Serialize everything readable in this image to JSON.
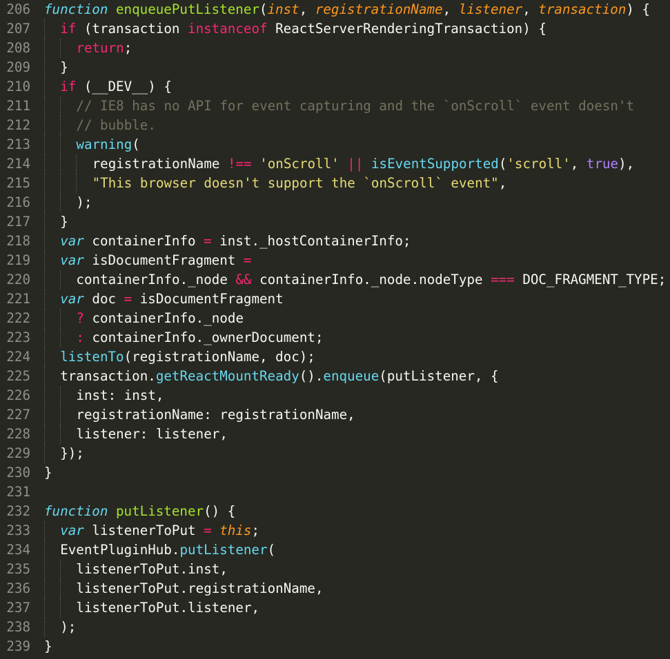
{
  "editor": {
    "theme": {
      "background": "#272822",
      "gutter": "#90908A"
    },
    "lines": [
      {
        "n": "206",
        "indent": 0,
        "tokens": [
          {
            "t": "sk",
            "v": "function"
          },
          {
            "t": "pl",
            "v": " "
          },
          {
            "t": "fn",
            "v": "enqueuePutListener"
          },
          {
            "t": "pl",
            "v": "("
          },
          {
            "t": "pa",
            "v": "inst"
          },
          {
            "t": "pl",
            "v": ", "
          },
          {
            "t": "pa",
            "v": "registrationName"
          },
          {
            "t": "pl",
            "v": ", "
          },
          {
            "t": "pa",
            "v": "listener"
          },
          {
            "t": "pl",
            "v": ", "
          },
          {
            "t": "pa",
            "v": "transaction"
          },
          {
            "t": "pl",
            "v": ") {"
          }
        ]
      },
      {
        "n": "207",
        "indent": 1,
        "tokens": [
          {
            "t": "kw",
            "v": "if"
          },
          {
            "t": "pl",
            "v": " (transaction "
          },
          {
            "t": "kw",
            "v": "instanceof"
          },
          {
            "t": "pl",
            "v": " ReactServerRenderingTransaction) {"
          }
        ]
      },
      {
        "n": "208",
        "indent": 2,
        "tokens": [
          {
            "t": "kw",
            "v": "return"
          },
          {
            "t": "pl",
            "v": ";"
          }
        ]
      },
      {
        "n": "209",
        "indent": 1,
        "tokens": [
          {
            "t": "pl",
            "v": "}"
          }
        ]
      },
      {
        "n": "210",
        "indent": 1,
        "tokens": [
          {
            "t": "kw",
            "v": "if"
          },
          {
            "t": "pl",
            "v": " (__DEV__) {"
          }
        ]
      },
      {
        "n": "211",
        "indent": 2,
        "tokens": [
          {
            "t": "cm",
            "v": "// IE8 has no API for event capturing and the `onScroll` event doesn't"
          }
        ]
      },
      {
        "n": "212",
        "indent": 2,
        "tokens": [
          {
            "t": "cm",
            "v": "// bubble."
          }
        ]
      },
      {
        "n": "213",
        "indent": 2,
        "tokens": [
          {
            "t": "sp",
            "v": "warning"
          },
          {
            "t": "pl",
            "v": "("
          }
        ]
      },
      {
        "n": "214",
        "indent": 3,
        "tokens": [
          {
            "t": "pl",
            "v": "registrationName "
          },
          {
            "t": "kw",
            "v": "!=="
          },
          {
            "t": "pl",
            "v": " "
          },
          {
            "t": "st",
            "v": "'onScroll'"
          },
          {
            "t": "pl",
            "v": " "
          },
          {
            "t": "kw",
            "v": "||"
          },
          {
            "t": "pl",
            "v": " "
          },
          {
            "t": "sp",
            "v": "isEventSupported"
          },
          {
            "t": "pl",
            "v": "("
          },
          {
            "t": "st",
            "v": "'scroll'"
          },
          {
            "t": "pl",
            "v": ", "
          },
          {
            "t": "co",
            "v": "true"
          },
          {
            "t": "pl",
            "v": "),"
          }
        ]
      },
      {
        "n": "215",
        "indent": 3,
        "tokens": [
          {
            "t": "st",
            "v": "\"This browser doesn't support the `onScroll` event\""
          },
          {
            "t": "pl",
            "v": ","
          }
        ]
      },
      {
        "n": "216",
        "indent": 2,
        "tokens": [
          {
            "t": "pl",
            "v": ");"
          }
        ]
      },
      {
        "n": "217",
        "indent": 1,
        "tokens": [
          {
            "t": "pl",
            "v": "}"
          }
        ]
      },
      {
        "n": "218",
        "indent": 1,
        "tokens": [
          {
            "t": "sk",
            "v": "var"
          },
          {
            "t": "pl",
            "v": " containerInfo "
          },
          {
            "t": "kw",
            "v": "="
          },
          {
            "t": "pl",
            "v": " inst._hostContainerInfo;"
          }
        ]
      },
      {
        "n": "219",
        "indent": 1,
        "tokens": [
          {
            "t": "sk",
            "v": "var"
          },
          {
            "t": "pl",
            "v": " isDocumentFragment "
          },
          {
            "t": "kw",
            "v": "="
          }
        ]
      },
      {
        "n": "220",
        "indent": 2,
        "tokens": [
          {
            "t": "pl",
            "v": "containerInfo._node "
          },
          {
            "t": "kw",
            "v": "&&"
          },
          {
            "t": "pl",
            "v": " containerInfo._node.nodeType "
          },
          {
            "t": "kw",
            "v": "==="
          },
          {
            "t": "pl",
            "v": " DOC_FRAGMENT_TYPE;"
          }
        ]
      },
      {
        "n": "221",
        "indent": 1,
        "tokens": [
          {
            "t": "sk",
            "v": "var"
          },
          {
            "t": "pl",
            "v": " doc "
          },
          {
            "t": "kw",
            "v": "="
          },
          {
            "t": "pl",
            "v": " isDocumentFragment"
          }
        ]
      },
      {
        "n": "222",
        "indent": 2,
        "tokens": [
          {
            "t": "kw",
            "v": "?"
          },
          {
            "t": "pl",
            "v": " containerInfo._node"
          }
        ]
      },
      {
        "n": "223",
        "indent": 2,
        "tokens": [
          {
            "t": "kw",
            "v": ":"
          },
          {
            "t": "pl",
            "v": " containerInfo._ownerDocument;"
          }
        ]
      },
      {
        "n": "224",
        "indent": 1,
        "tokens": [
          {
            "t": "sp",
            "v": "listenTo"
          },
          {
            "t": "pl",
            "v": "(registrationName, doc);"
          }
        ]
      },
      {
        "n": "225",
        "indent": 1,
        "tokens": [
          {
            "t": "pl",
            "v": "transaction."
          },
          {
            "t": "sp",
            "v": "getReactMountReady"
          },
          {
            "t": "pl",
            "v": "()."
          },
          {
            "t": "sp",
            "v": "enqueue"
          },
          {
            "t": "pl",
            "v": "(putListener, {"
          }
        ]
      },
      {
        "n": "226",
        "indent": 2,
        "tokens": [
          {
            "t": "pl",
            "v": "inst: inst,"
          }
        ]
      },
      {
        "n": "227",
        "indent": 2,
        "tokens": [
          {
            "t": "pl",
            "v": "registrationName: registrationName,"
          }
        ]
      },
      {
        "n": "228",
        "indent": 2,
        "tokens": [
          {
            "t": "pl",
            "v": "listener: listener,"
          }
        ]
      },
      {
        "n": "229",
        "indent": 1,
        "tokens": [
          {
            "t": "pl",
            "v": "});"
          }
        ]
      },
      {
        "n": "230",
        "indent": 0,
        "tokens": [
          {
            "t": "pl",
            "v": "}"
          }
        ]
      },
      {
        "n": "231",
        "indent": 0,
        "tokens": []
      },
      {
        "n": "232",
        "indent": 0,
        "tokens": [
          {
            "t": "sk",
            "v": "function"
          },
          {
            "t": "pl",
            "v": " "
          },
          {
            "t": "fn",
            "v": "putListener"
          },
          {
            "t": "pl",
            "v": "() {"
          }
        ]
      },
      {
        "n": "233",
        "indent": 1,
        "tokens": [
          {
            "t": "sk",
            "v": "var"
          },
          {
            "t": "pl",
            "v": " listenerToPut "
          },
          {
            "t": "kw",
            "v": "="
          },
          {
            "t": "pl",
            "v": " "
          },
          {
            "t": "sf",
            "v": "this"
          },
          {
            "t": "pl",
            "v": ";"
          }
        ]
      },
      {
        "n": "234",
        "indent": 1,
        "tokens": [
          {
            "t": "pl",
            "v": "EventPluginHub."
          },
          {
            "t": "sp",
            "v": "putListener"
          },
          {
            "t": "pl",
            "v": "("
          }
        ]
      },
      {
        "n": "235",
        "indent": 2,
        "tokens": [
          {
            "t": "pl",
            "v": "listenerToPut.inst,"
          }
        ]
      },
      {
        "n": "236",
        "indent": 2,
        "tokens": [
          {
            "t": "pl",
            "v": "listenerToPut.registrationName,"
          }
        ]
      },
      {
        "n": "237",
        "indent": 2,
        "tokens": [
          {
            "t": "pl",
            "v": "listenerToPut.listener,"
          }
        ]
      },
      {
        "n": "238",
        "indent": 1,
        "tokens": [
          {
            "t": "pl",
            "v": ");"
          }
        ]
      },
      {
        "n": "239",
        "indent": 0,
        "tokens": [
          {
            "t": "pl",
            "v": "}"
          }
        ]
      }
    ]
  }
}
